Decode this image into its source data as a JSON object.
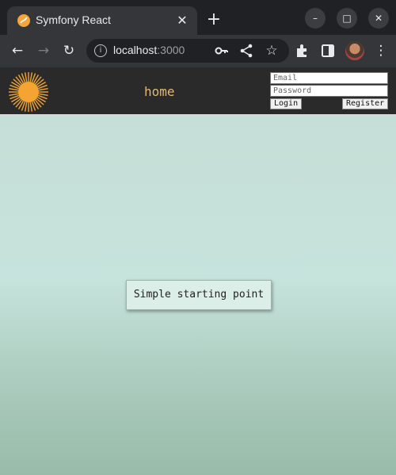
{
  "browser": {
    "tab_title": "Symfony React",
    "tab_close_glyph": "✕",
    "new_tab_glyph": "+",
    "url_host": "localhost",
    "url_port": ":3000",
    "window_controls": {
      "minimize": "–",
      "maximize": "□",
      "close": "✕"
    },
    "icons": [
      "back-arrow-icon",
      "forward-arrow-icon",
      "reload-icon",
      "info-icon",
      "key-icon",
      "share-icon",
      "star-icon",
      "extensions-icon",
      "side-panel-icon",
      "avatar",
      "more-menu-icon"
    ]
  },
  "header": {
    "nav_home": "home",
    "email_placeholder": "Email",
    "password_placeholder": "Password",
    "login_label": "Login",
    "register_label": "Register"
  },
  "main": {
    "card_text": "Simple starting point"
  },
  "colors": {
    "header_bg": "#2a2a2a",
    "nav_link": "#e3b777",
    "page_bg_top": "#c6ddd6",
    "page_bg_bottom": "#98bca9",
    "logo": "#f4a531"
  }
}
